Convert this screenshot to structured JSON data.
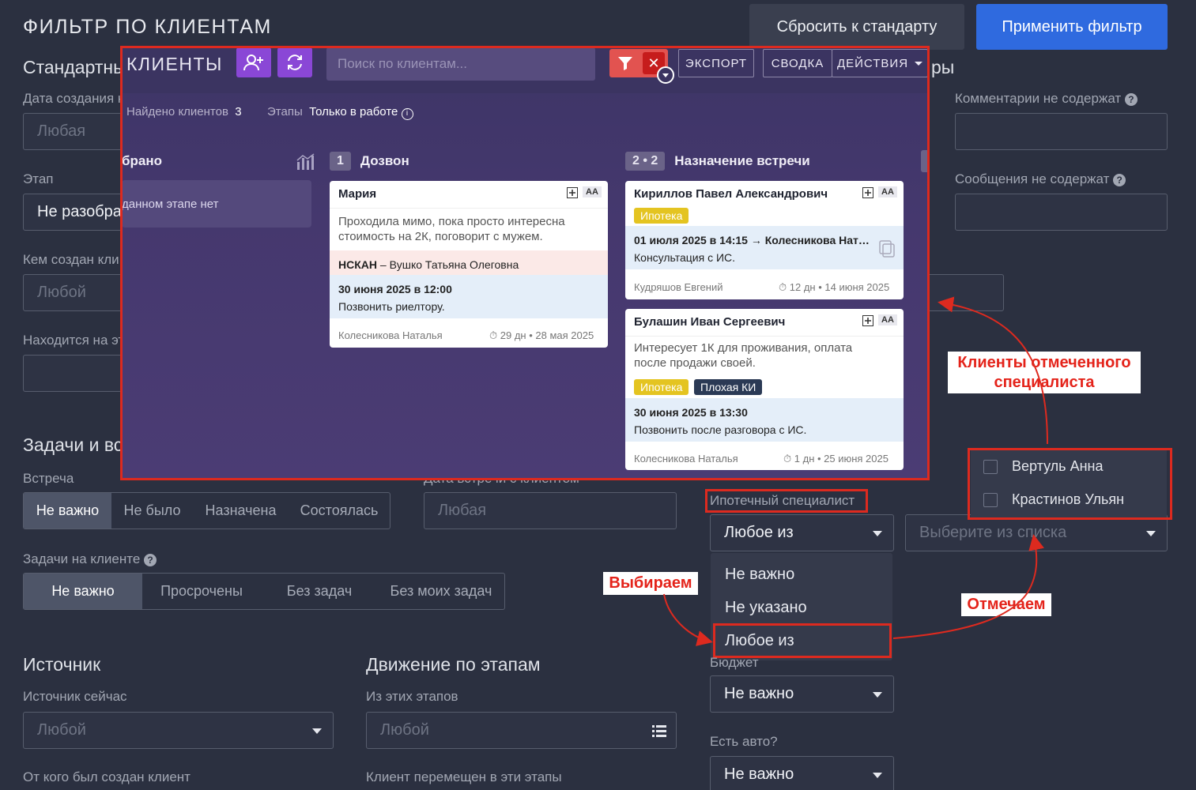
{
  "header": {
    "title": "ФИЛЬТР ПО КЛИЕНТАМ",
    "reset": "Сбросить к стандарту",
    "apply": "Применить фильтр"
  },
  "bg": {
    "standard": "Стандартные",
    "right_head": "ры",
    "created_label": "Дата создания к",
    "created_value": "Любая",
    "stage_label": "Этап",
    "stage_value": "Не разобрано",
    "creator_label": "Кем создан кли",
    "creator_value": "Любой",
    "onstage_label": "Находится на эт",
    "comments_label": "Комментарии не содержат",
    "messages_label": "Сообщения не содержат",
    "tasks_section": "Задачи и вс",
    "meeting_label": "Встреча",
    "meeting_opts": [
      "Не важно",
      "Не было",
      "Назначена",
      "Состоялась"
    ],
    "meeting_date_label": "Дата встречи с клиентом",
    "meeting_date_value": "Любая",
    "tasks_label": "Задачи на клиенте",
    "tasks_opts": [
      "Не важно",
      "Просрочены",
      "Без задач",
      "Без моих задач"
    ],
    "source_section": "Источник",
    "source_now_label": "Источник сейчас",
    "source_now_value": "Любой",
    "source_from_label": "От кого был создан клиент",
    "moves_section": "Движение по этапам",
    "moves_from_label": "Из этих этапов",
    "moves_from_value": "Любой",
    "moves_to_label": "Клиент перемещен в эти этапы",
    "mortgage_label": "Ипотечный специалист",
    "mortgage_value": "Любое из",
    "select_placeholder": "Выберите из списка",
    "budget_label": "Бюджет",
    "budget_value": "Не важно",
    "car_label": "Есть авто?",
    "car_value": "Не важно"
  },
  "dropdown": [
    "Не важно",
    "Не указано",
    "Любое из"
  ],
  "specialists": [
    "Вертуль Анна",
    "Крастинов Ульян"
  ],
  "annotations": {
    "clients": "Клиенты отмеченного",
    "clients2": "специалиста",
    "choose": "Выбираем",
    "mark": "Отмечаем"
  },
  "overlay": {
    "title": "КЛИЕНТЫ",
    "search_placeholder": "Поиск по клиентам...",
    "export": "ЭКСПОРТ",
    "summary": "СВОДКА",
    "actions": "ДЕЙСТВИЯ",
    "found_label": "Найдено клиентов",
    "found_count": "3",
    "stages_label": "Этапы",
    "stages_value": "Только в работе",
    "col0": "брано",
    "col0_empty": "данном этапе нет",
    "col1_num": "1",
    "col1": "Дозвон",
    "col2_num": "2 • 2",
    "col2": "Назначение встречи",
    "card1": {
      "name": "Мария",
      "aa": "AA",
      "text1": "Проходила мимо, пока просто интересна",
      "text2": "стоимость на 2К, поговорит с мужем.",
      "src_bold": "НСКАН",
      "src_rest": " – Вушко Татьяна Олеговна",
      "task_date": "30 июня 2025 в 12:00",
      "task_text": "Позвонить риелтору.",
      "owner": "Колесникова Наталья",
      "age": "29 дн • 28 мая 2025"
    },
    "card2": {
      "name": "Кириллов Павел Александрович",
      "aa": "AA",
      "tag": "Ипотека",
      "task_date": "01 июля 2025 в 14:15 → Колесникова Нат…",
      "task_text": "Консультация с ИС.",
      "owner": "Кудряшов Евгений",
      "age": "12 дн • 14 июня 2025"
    },
    "card3": {
      "name": "Булашин Иван Сергеевич",
      "aa": "AA",
      "text1": "Интересует 1К для проживания, оплата",
      "text2": "после продажи своей.",
      "tag1": "Ипотека",
      "tag2": "Плохая КИ",
      "task_date": "30 июня 2025 в 13:30",
      "task_text": "Позвонить после разговора с ИС.",
      "owner": "Колесникова Наталья",
      "age": "1 дн • 25 июня 2025"
    }
  }
}
